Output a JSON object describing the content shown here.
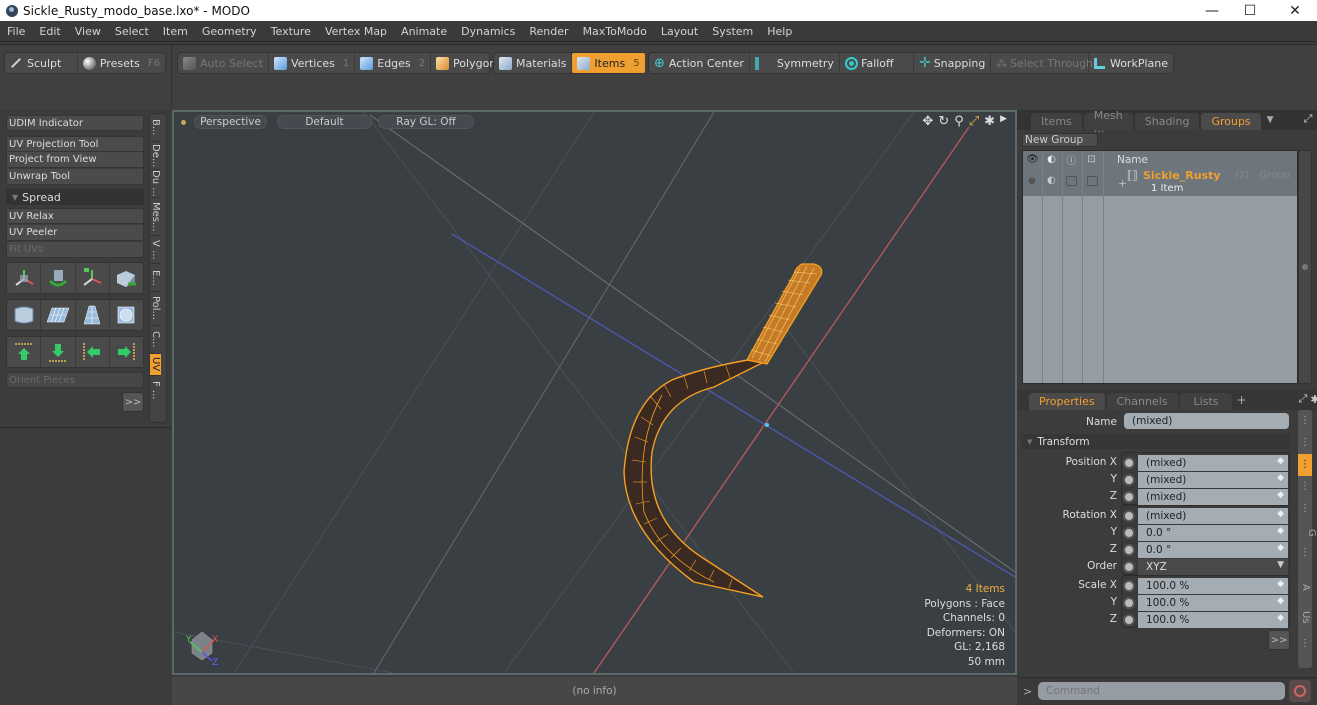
{
  "window": {
    "title": "Sickle_Rusty_modo_base.lxo* - MODO",
    "controls": [
      "minimize",
      "maximize",
      "close"
    ]
  },
  "menu": [
    "File",
    "Edit",
    "View",
    "Select",
    "Item",
    "Geometry",
    "Texture",
    "Vertex Map",
    "Animate",
    "Dynamics",
    "Render",
    "MaxToModo",
    "Layout",
    "System",
    "Help"
  ],
  "toolbar": {
    "sculpt": "Sculpt",
    "presets": "Presets",
    "presets_key": "F6",
    "auto_select": "Auto Select",
    "vertices": "Vertices",
    "vertices_key": "1",
    "edges": "Edges",
    "edges_key": "2",
    "polygons": "Polygons",
    "materials": "Materials",
    "items": "Items",
    "items_key": "5",
    "action_center": "Action Center",
    "symmetry": "Symmetry",
    "falloff": "Falloff",
    "snapping": "Snapping",
    "select_through": "Select Through",
    "workplane": "WorkPlane"
  },
  "left_panel": {
    "udim": "UDIM Indicator",
    "uv_projection": "UV Projection Tool",
    "project_view": "Project from View",
    "unwrap": "Unwrap Tool",
    "spread": "Spread",
    "uv_relax": "UV Relax",
    "uv_peeler": "UV Peeler",
    "fit_uvs": "Fit UVs",
    "orient": "Orient Pieces",
    "more": ">>",
    "vtabs": [
      "B...",
      "De...",
      "Du ...",
      "Mes...",
      "V ...",
      "E...",
      "Pol...",
      "C...",
      "UV",
      "F ..."
    ],
    "active_vtab": "UV"
  },
  "viewport": {
    "view": "Perspective",
    "shading": "Default",
    "raygl": "Ray GL: Off",
    "stats": {
      "items": "4 Items",
      "polygons": "Polygons : Face",
      "channels": "Channels: 0",
      "deformers": "Deformers: ON",
      "gl": "GL: 2,168",
      "scale": "50 mm"
    },
    "axes": {
      "x": "X",
      "y": "Y",
      "z": "Z"
    },
    "status": "(no info)",
    "colors": {
      "wire": "#f5a020",
      "x_axis": "#c05050",
      "z_axis": "#4050b0"
    }
  },
  "groups_panel": {
    "tabs": [
      "Items",
      "Mesh ...",
      "Shading",
      "Groups"
    ],
    "active_tab": "Groups",
    "new_group": "New Group",
    "col_name": "Name",
    "group": {
      "name": "Sickle_Rusty",
      "count": "(2)",
      "type": ": Group",
      "sub": "1 Item"
    }
  },
  "properties": {
    "tabs": [
      "Properties",
      "Channels",
      "Lists",
      "+"
    ],
    "active_tab": "Properties",
    "name_label": "Name",
    "name_value": "(mixed)",
    "transform": "Transform",
    "rows": [
      {
        "label": "Position X",
        "value": "(mixed)"
      },
      {
        "label": "Y",
        "value": "(mixed)"
      },
      {
        "label": "Z",
        "value": "(mixed)"
      },
      {
        "label": "Rotation X",
        "value": "(mixed)"
      },
      {
        "label": "Y",
        "value": "0.0 °"
      },
      {
        "label": "Z",
        "value": "0.0 °"
      },
      {
        "label": "Order",
        "value": "XYZ"
      },
      {
        "label": "Scale X",
        "value": "100.0 %"
      },
      {
        "label": "Y",
        "value": "100.0 %"
      },
      {
        "label": "Z",
        "value": "100.0 %"
      }
    ],
    "more": ">>",
    "side_tabs": [
      "⋮",
      "⋮",
      "⋮",
      "⋮",
      "⋮",
      "G",
      "⋮",
      "A",
      "Us",
      "⋮"
    ]
  },
  "command": {
    "prompt": ">",
    "placeholder": "Command"
  }
}
